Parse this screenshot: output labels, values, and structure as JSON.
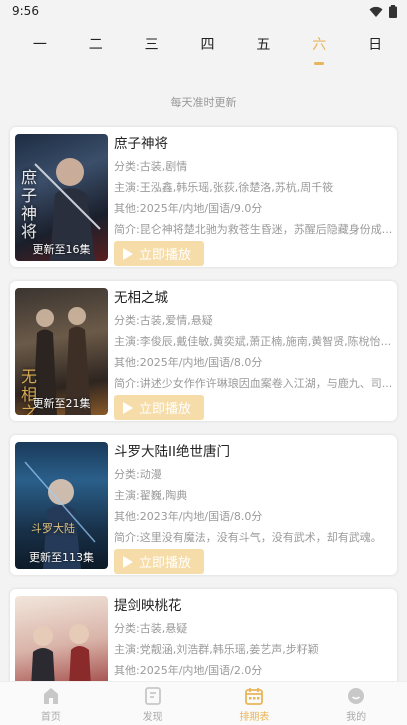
{
  "status": {
    "time": "9:56"
  },
  "weekdays": [
    "一",
    "二",
    "三",
    "四",
    "五",
    "六",
    "日"
  ],
  "active_day": "六",
  "subtitle": "每天准时更新",
  "accent_color": "#e8b65a",
  "play_label": "立即播放",
  "cards": [
    {
      "title": "庶子神将",
      "genre": "分类:古装,剧情",
      "cast": "主演:王泓鑫,韩乐瑶,张荻,徐楚洛,苏杭,周千筱",
      "other": "其他:2025年/内地/国语/9.0分",
      "intro": "简介:昆仑神将楚北驰为救苍生昏迷，苏醒后隐藏身份成...",
      "update": "更新至16集",
      "poster_text": "庶子神将"
    },
    {
      "title": "无相之城",
      "genre": "分类:古装,爱情,悬疑",
      "cast": "主演:李俊辰,戴佳敏,黄奕斌,萧正楠,施南,黄智贤,陈梲怡...",
      "other": "其他:2025年/内地/国语/8.0分",
      "intro": "简介:讲述少女作作许琳琅因血案卷入江湖，与鹿九、司...",
      "update": "更新至21集",
      "poster_text": "无相之城"
    },
    {
      "title": "斗罗大陆II绝世唐门",
      "genre": "分类:动漫",
      "cast": "主演:翟巍,陶典",
      "other": "其他:2023年/内地/国语/8.0分",
      "intro": "简介:这里没有魔法，没有斗气，没有武术，却有武魂。",
      "update": "更新至113集",
      "poster_text": "斗罗大陆"
    },
    {
      "title": "提剑映桃花",
      "genre": "分类:古装,悬疑",
      "cast": "主演:党靓涵,刘浩群,韩乐瑶,姜艺声,步籽颖",
      "other": "其他:2025年/内地/国语/2.0分",
      "intro": "",
      "update": "",
      "poster_text": ""
    }
  ],
  "tabs": [
    {
      "label": "首页",
      "icon": "home-icon"
    },
    {
      "label": "发现",
      "icon": "discover-icon"
    },
    {
      "label": "排期表",
      "icon": "calendar-icon"
    },
    {
      "label": "我的",
      "icon": "profile-icon"
    }
  ],
  "active_tab": "排期表"
}
